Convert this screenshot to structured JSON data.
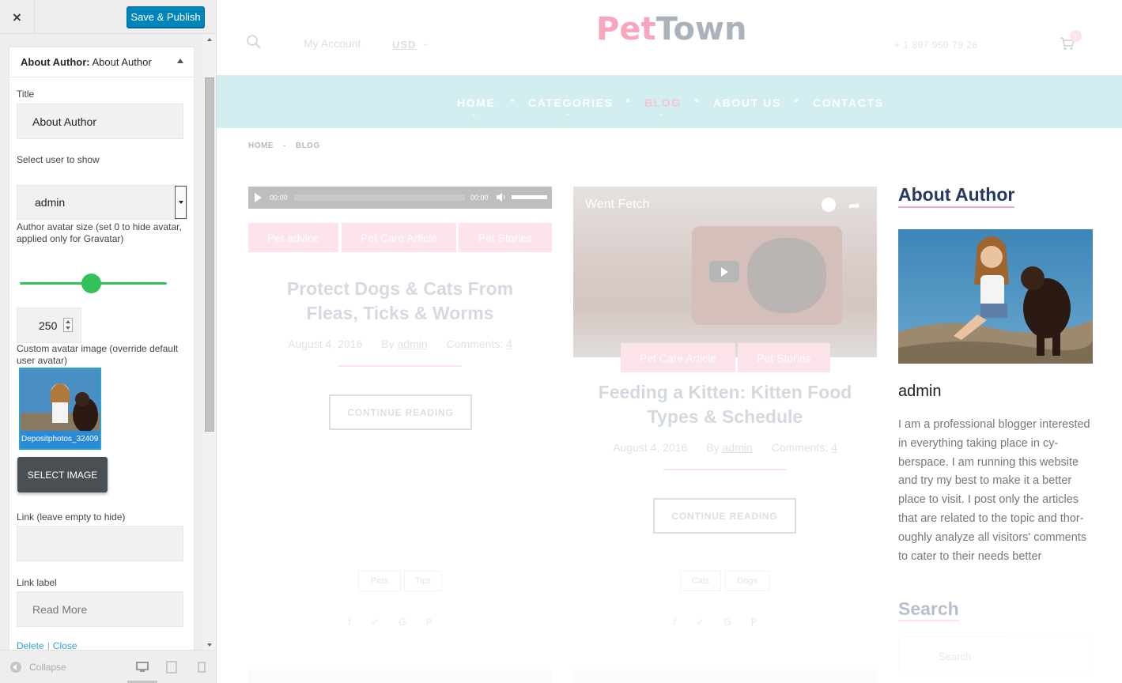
{
  "customizer": {
    "close_label": "×",
    "save_label": "Save & Publish",
    "widget": {
      "header_prefix": "About Author:",
      "header_name": "About Author",
      "title_label": "Title",
      "title_value": "About Author",
      "user_label": "Select user to show",
      "user_value": "admin",
      "avatar_size_label": "Author avatar size (set 0 to hide avatar, applied only for Gravatar)",
      "avatar_size_value": "250",
      "avatar_size_fraction": 0.5,
      "custom_avatar_label": "Custom avatar image (override default user avatar)",
      "avatar_filename": "Depositphotos_32409",
      "select_image_label": "SELECT IMAGE",
      "link_label": "Link (leave empty to hide)",
      "link_value": "",
      "link_label_label": "Link label",
      "link_label_placeholder": "Read More",
      "delete_label": "Delete",
      "close_label": "Close"
    },
    "collapse_label": "Collapse",
    "devices": [
      "desktop-icon",
      "tablet-icon",
      "mobile-icon"
    ]
  },
  "site": {
    "my_account": "My Account",
    "currency": "USD",
    "logo_part1": "Pet",
    "logo_part2": "Town",
    "phone": "+ 1 897 959 79 26",
    "cart_count": "1",
    "nav": [
      "HOME",
      "CATEGORIES",
      "BLOG",
      "ABOUT US",
      "CONTACTS"
    ],
    "active_nav": "BLOG",
    "breadcrumb": [
      "HOME",
      "BLOG"
    ],
    "posts": [
      {
        "audio_time_start": "00:00",
        "audio_time_end": "00:00",
        "categories": [
          "Pet advice",
          "Pet Care Article",
          "Pet Stories"
        ],
        "title_line1": "Protect Dogs & Cats From",
        "title_line2": "Fleas, Ticks & Worms",
        "date": "August 4, 2016",
        "by": "By",
        "author": "admin",
        "comments_label": "Comments:",
        "comments": "4",
        "button": "CONTINUE READING",
        "tags": [
          "Pets",
          "Tips"
        ]
      },
      {
        "video_title": "Went Fetch",
        "categories": [
          "Pet Care Article",
          "Pet Stories"
        ],
        "title_line1": "Feeding a Kitten: Kitten Food",
        "title_line2": "Types & Schedule",
        "date": "August 4, 2016",
        "by": "By",
        "author": "admin",
        "comments_label": "Comments:",
        "comments": "4",
        "button": "CONTINUE READING",
        "tags": [
          "Cats",
          "Dogs"
        ]
      }
    ],
    "sidebar": {
      "widget_title": "About Author",
      "author_name": "admin",
      "author_bio": "I am a professional blogger interested in everything taking place in cy-berspace. I am running this website and try my best to make it a better place to visit. I post only the articles that are related to the topic and thor-oughly analyze all visitors' comments to cater to their needs better",
      "search_title": "Search",
      "search_placeholder": "Search"
    }
  },
  "colors": {
    "accent_blue": "#0085ba",
    "slider_green": "#33c25a",
    "brand_pink": "#f7a6be",
    "nav_bg": "#d3eef0",
    "heading_navy": "#243a63"
  }
}
